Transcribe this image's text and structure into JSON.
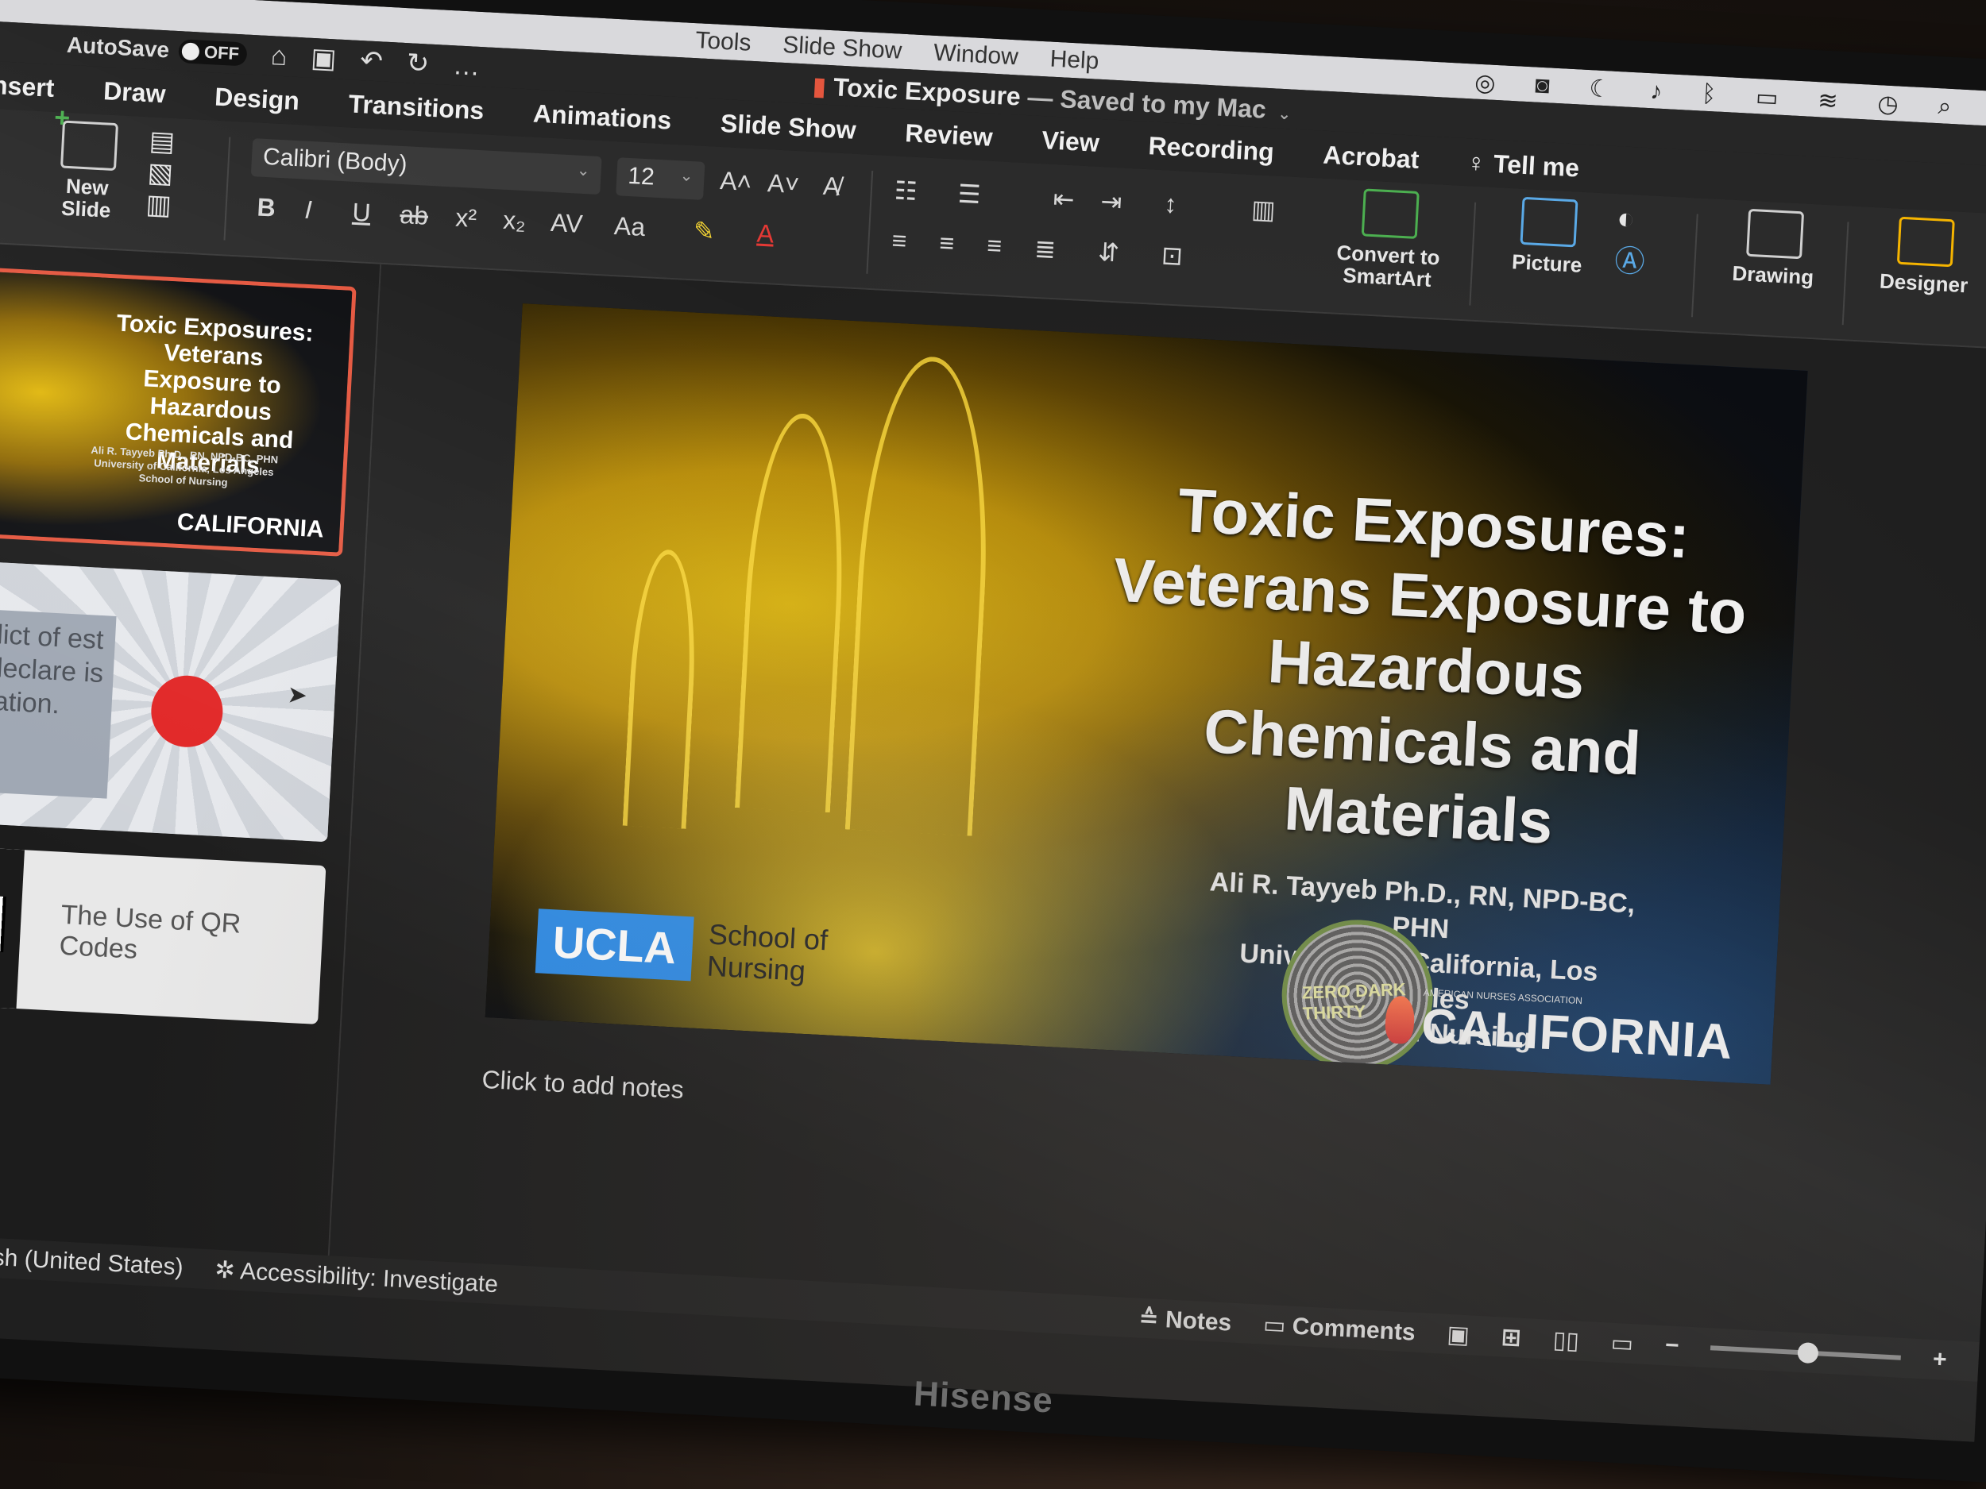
{
  "os_menu": {
    "items": [
      "Tools",
      "Slide Show",
      "Window",
      "Help"
    ],
    "status_icons": [
      "creative-cloud-icon",
      "camera-icon",
      "moon-icon",
      "volume-icon",
      "bluetooth-icon",
      "battery-icon",
      "wifi-icon",
      "clock-icon",
      "search-icon",
      "control-center-icon"
    ]
  },
  "titlebar": {
    "autosave_label": "AutoSave",
    "autosave_state": "OFF",
    "doc_title": "Toxic Exposure",
    "saved_status": "— Saved to my Mac"
  },
  "tabs": [
    "Insert",
    "Draw",
    "Design",
    "Transitions",
    "Animations",
    "Slide Show",
    "Review",
    "View",
    "Recording",
    "Acrobat"
  ],
  "tell_me": "Tell me",
  "ribbon": {
    "new_slide": "New Slide",
    "font_name": "Calibri (Body)",
    "font_size": "12",
    "convert_smartart": "Convert to SmartArt",
    "picture": "Picture",
    "drawing": "Drawing",
    "designer": "Designer"
  },
  "slide": {
    "title": "Toxic Exposures: Veterans Exposure to Hazardous Chemicals and Materials",
    "author": "Ali R. Tayyeb Ph.D., RN, NPD-BC, PHN",
    "affiliation_1": "University of California, Los Angeles",
    "affiliation_2": "School of Nursing",
    "ucla": "UCLA",
    "ucla_school": "School of Nursing",
    "seal_text": "ZERO DARK THIRTY",
    "ana_small": "AMERICAN NURSES ASSOCIATION",
    "ana_big": "CALIFORNIA"
  },
  "thumbnails": {
    "t1_title": "Toxic Exposures: Veterans Exposure to Hazardous Chemicals and Materials",
    "t1_author": "Ali R. Tayyeb Ph.D., RN, NPD-BC, PHN University of California, Los Angeles School of Nursing",
    "t1_logo": "CALIFORNIA",
    "t2_text": "onflict of est to declare is entation.",
    "t3_title": "The Use of QR Codes"
  },
  "notes_placeholder": "Click to add notes",
  "status": {
    "language": "English (United States)",
    "accessibility": "Accessibility: Investigate",
    "notes": "Notes",
    "comments": "Comments"
  },
  "monitor_brand": "Hisense",
  "colors": {
    "thumb_selected_border": "#e4563e",
    "ucla_blue": "#2d8be6"
  }
}
